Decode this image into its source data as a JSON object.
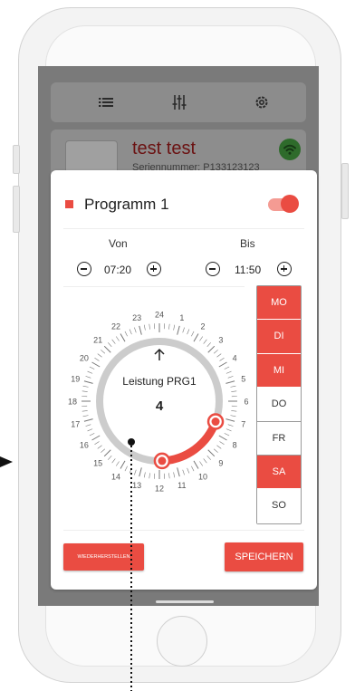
{
  "device": {
    "name": "test test",
    "serial": "Seriennummer: P133123123"
  },
  "program": {
    "title": "Programm 1",
    "enabled": true
  },
  "time": {
    "from_label": "Von",
    "from_value": "07:20",
    "to_label": "Bis",
    "to_value": "11:50"
  },
  "dial": {
    "center_label": "Leistung PRG1",
    "center_value": "4",
    "hour_labels": [
      "24",
      "1",
      "2",
      "3",
      "4",
      "5",
      "6",
      "7",
      "8",
      "9",
      "10",
      "11",
      "12",
      "13",
      "14",
      "15",
      "16",
      "17",
      "18",
      "19",
      "20",
      "21",
      "22",
      "23"
    ],
    "start_hour": 7.33,
    "end_hour": 11.83
  },
  "days": [
    {
      "label": "MO",
      "active": true
    },
    {
      "label": "DI",
      "active": true
    },
    {
      "label": "MI",
      "active": true
    },
    {
      "label": "DO",
      "active": false
    },
    {
      "label": "FR",
      "active": false
    },
    {
      "label": "SA",
      "active": true
    },
    {
      "label": "SO",
      "active": false
    }
  ],
  "buttons": {
    "restore_label": "WIEDERHERSTELLEN",
    "save_label": "SPEICHERN"
  },
  "colors": {
    "accent": "#ea4c42",
    "accent_light": "#f49b93",
    "track": "#cccccc",
    "wifi_green": "#2e6b2b"
  },
  "icons": {
    "menu": "list-icon",
    "filters": "sliders-icon",
    "settings": "gear-icon",
    "wifi": "wifi-icon",
    "arrow": "arrow-up-icon"
  }
}
